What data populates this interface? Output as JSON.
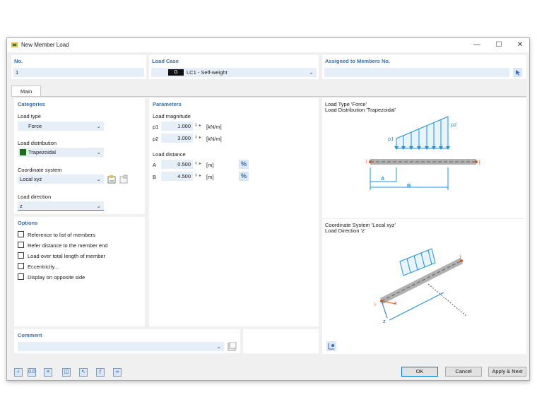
{
  "window": {
    "title": "New Member Load",
    "min": "—",
    "max": "☐",
    "close": "✕"
  },
  "top": {
    "no_label": "No.",
    "no_value": "1",
    "load_case_label": "Load Case",
    "load_case_badge": "G",
    "load_case_value": "LC1 - Self-weight",
    "assigned_label": "Assigned to Members No.",
    "assigned_value": ""
  },
  "tabs": [
    {
      "label": "Main"
    }
  ],
  "categories": {
    "heading": "Categories",
    "load_type_label": "Load type",
    "load_type_value": "Force",
    "load_distribution_label": "Load distribution",
    "load_distribution_value": "Trapezoidal",
    "coord_label": "Coordinate system",
    "coord_value": "Local xyz",
    "direction_label": "Load direction",
    "direction_value": "z"
  },
  "options": {
    "heading": "Options",
    "items": [
      "Reference to list of members",
      "Refer distance to the member end",
      "Load over total length of member",
      "Eccentricity...",
      "Display on opposite side"
    ]
  },
  "parameters": {
    "heading": "Parameters",
    "magnitude_label": "Load magnitude",
    "p1_label": "p1",
    "p1_value": "1.000",
    "p1_unit": "[kN/m]",
    "p2_label": "p2",
    "p2_value": "3.000",
    "p2_unit": "[kN/m]",
    "distance_label": "Load distance",
    "a_label": "A",
    "a_value": "0.500",
    "a_unit": "[m]",
    "b_label": "B",
    "b_value": "4.500",
    "b_unit": "[m]",
    "pct": "%"
  },
  "preview1": {
    "line1": "Load Type 'Force'",
    "line2": "Load Distribution 'Trapezoidal'",
    "p1": "p1",
    "p2": "p2",
    "i": "i",
    "j": "j",
    "a": "A",
    "b": "B"
  },
  "preview2": {
    "line1": "Coordinate System 'Local xyz'",
    "line2": "Load Direction 'z'",
    "i": "i",
    "j": "j",
    "x": "x",
    "z": "z"
  },
  "comment": {
    "label": "Comment",
    "value": ""
  },
  "buttons": {
    "ok": "OK",
    "cancel": "Cancel",
    "apply_next": "Apply & Next"
  },
  "colors": {
    "accent": "#3a6ea8",
    "load": "#1e90d8",
    "member": "#a0a0a0",
    "node": "#e05020",
    "trap": "#1b6b1b"
  }
}
